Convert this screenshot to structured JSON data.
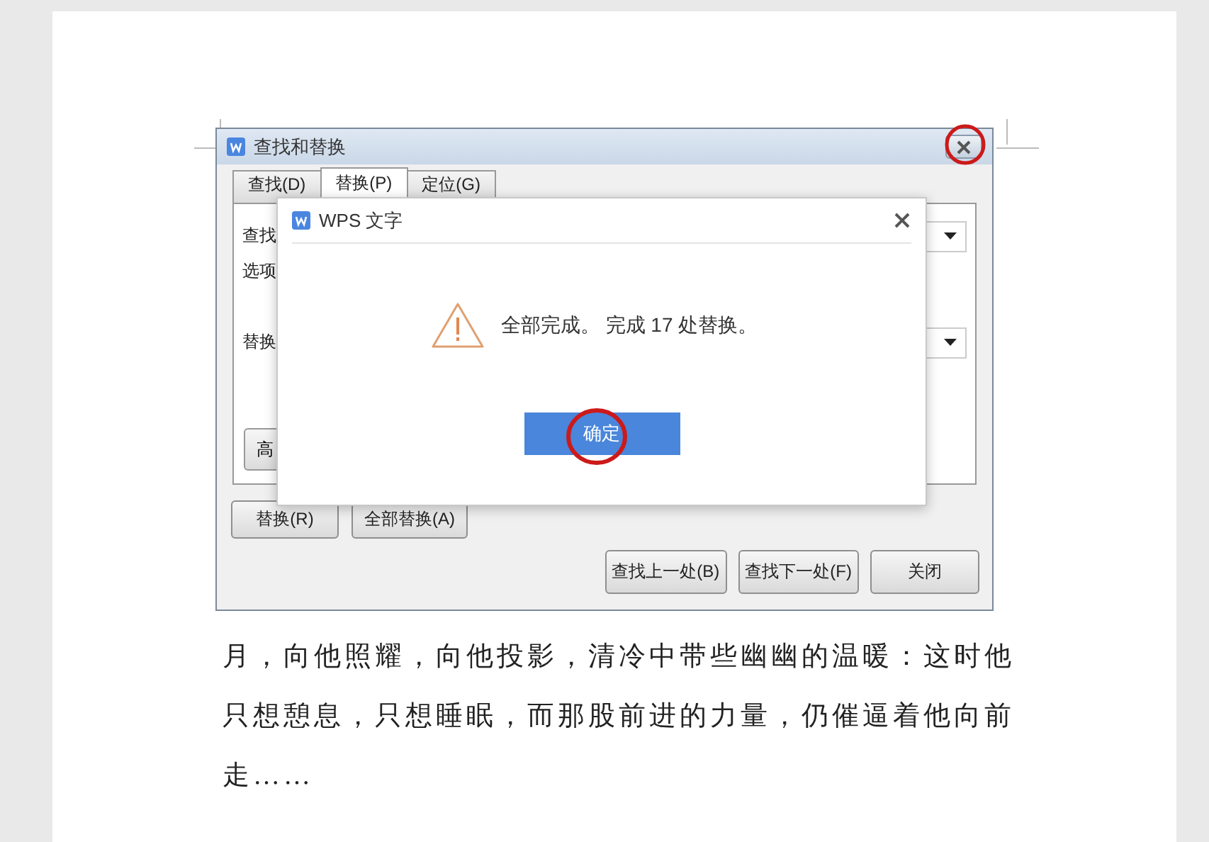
{
  "find_dialog": {
    "title": "查找和替换",
    "tabs": [
      {
        "label": "查找(D)",
        "selected": false
      },
      {
        "label": "替换(P)",
        "selected": true
      },
      {
        "label": "定位(G)",
        "selected": false
      }
    ],
    "fields": [
      {
        "label": "查找",
        "kind": "dropdown"
      },
      {
        "label": "选项",
        "kind": "text"
      },
      {
        "label": "替换",
        "kind": "dropdown"
      }
    ],
    "advanced_button": "高",
    "action_buttons": [
      "替换(R)",
      "全部替换(A)"
    ],
    "footer_buttons": [
      "查找上一处(B)",
      "查找下一处(F)",
      "关闭"
    ]
  },
  "message_box": {
    "title": "WPS 文字",
    "message": "全部完成。 完成 17 处替换。",
    "ok_button": "确定"
  },
  "document": {
    "lines": [
      "月，向他照耀，向他投影，清冷中带些幽幽的温暖：这时他",
      "只想憩息，只想睡眠，而那股前进的力量，仍催逼着他向前",
      "走……"
    ]
  }
}
